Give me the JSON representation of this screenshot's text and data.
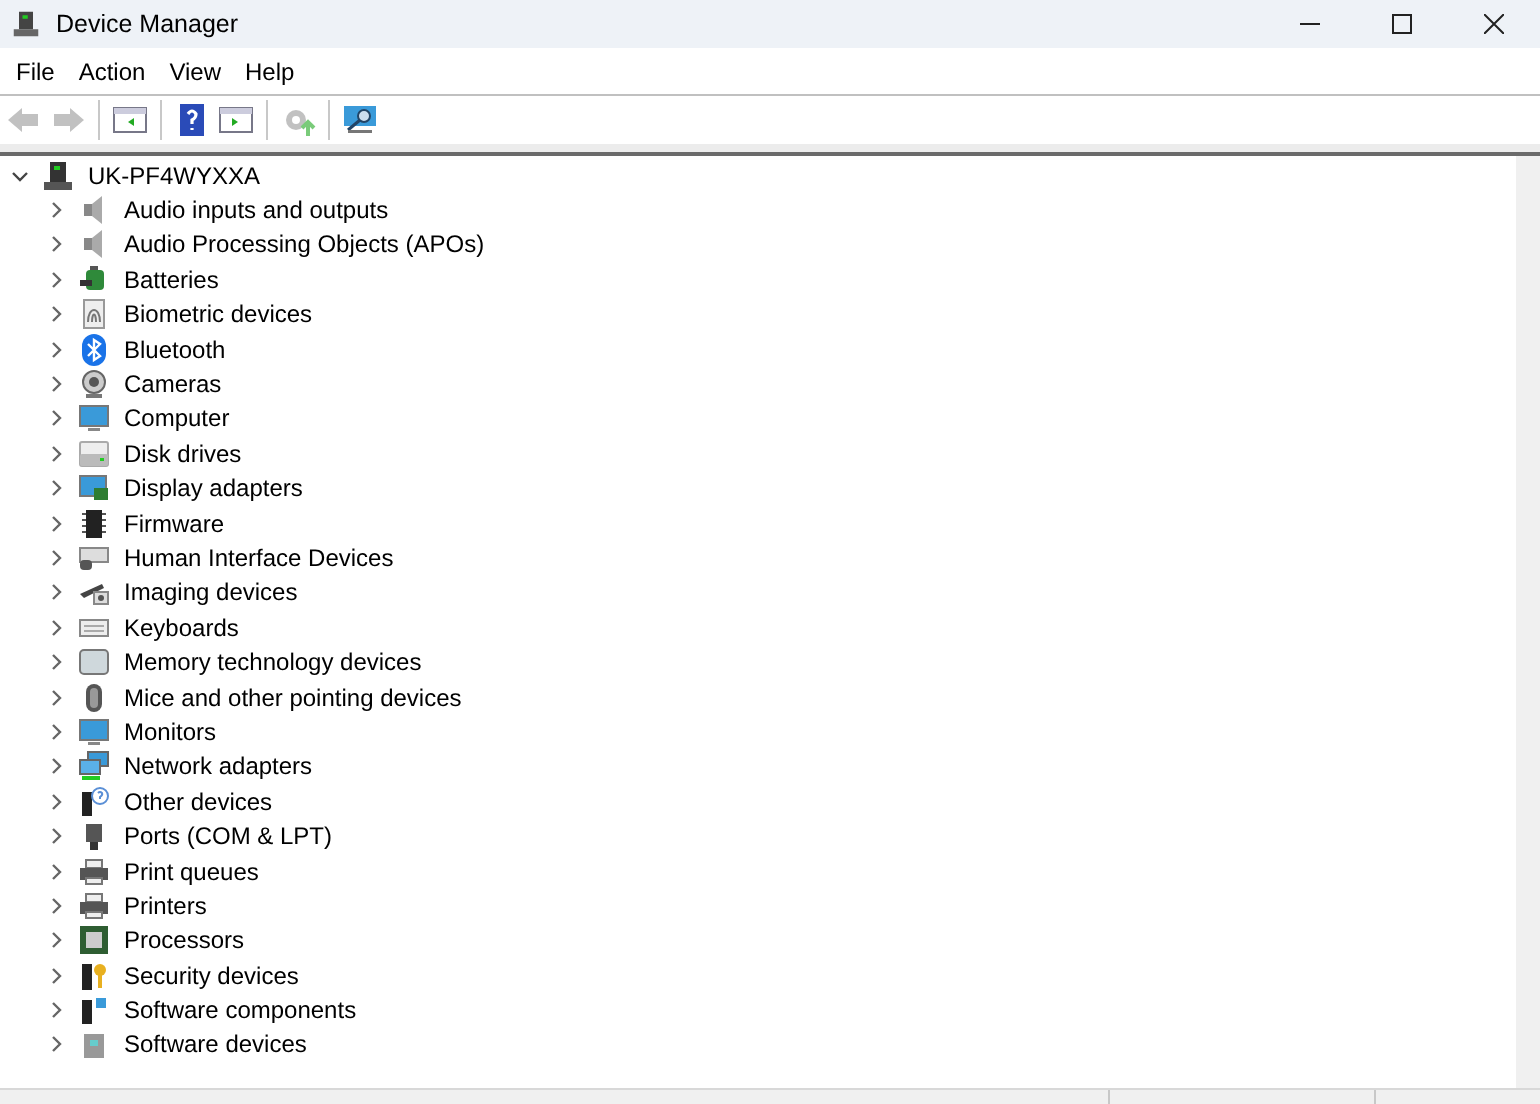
{
  "window": {
    "title": "Device Manager"
  },
  "menu": [
    "File",
    "Action",
    "View",
    "Help"
  ],
  "tree": {
    "label": "UK-PF4WYXXA",
    "expanded": true,
    "children": [
      {
        "label": "Audio inputs and outputs",
        "expanded": false
      },
      {
        "label": "Audio Processing Objects (APOs)",
        "expanded": false
      },
      {
        "label": "Batteries",
        "expanded": false
      },
      {
        "label": "Biometric devices",
        "expanded": false
      },
      {
        "label": "Bluetooth",
        "expanded": false
      },
      {
        "label": "Cameras",
        "expanded": false
      },
      {
        "label": "Computer",
        "expanded": false
      },
      {
        "label": "Disk drives",
        "expanded": false
      },
      {
        "label": "Display adapters",
        "expanded": false
      },
      {
        "label": "Firmware",
        "expanded": false
      },
      {
        "label": "Human Interface Devices",
        "expanded": false
      },
      {
        "label": "Imaging devices",
        "expanded": false
      },
      {
        "label": "Keyboards",
        "expanded": false
      },
      {
        "label": "Memory technology devices",
        "expanded": false
      },
      {
        "label": "Mice and other pointing devices",
        "expanded": false
      },
      {
        "label": "Monitors",
        "expanded": false
      },
      {
        "label": "Network adapters",
        "expanded": false
      },
      {
        "label": "Other devices",
        "expanded": false
      },
      {
        "label": "Ports (COM & LPT)",
        "expanded": false
      },
      {
        "label": "Print queues",
        "expanded": false
      },
      {
        "label": "Printers",
        "expanded": false
      },
      {
        "label": "Processors",
        "expanded": false
      },
      {
        "label": "Security devices",
        "expanded": false
      },
      {
        "label": "Software components",
        "expanded": false
      },
      {
        "label": "Software devices",
        "expanded": false
      }
    ]
  }
}
